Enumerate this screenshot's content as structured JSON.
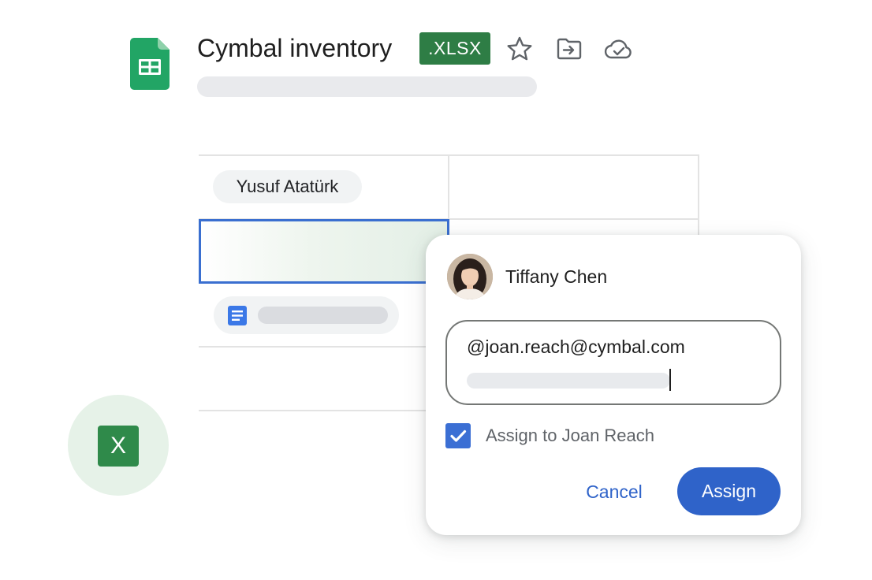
{
  "document": {
    "title": "Cymbal inventory",
    "format_badge": ".XLSX",
    "icons": [
      "google-sheets-icon",
      "star-icon",
      "move-to-folder-icon",
      "cloud-saved-icon"
    ]
  },
  "sheet": {
    "person_chip": "Yusuf Atatürk",
    "doc_chip_icon": "google-docs-icon"
  },
  "excel_icon": {
    "label": "X",
    "icon": "microsoft-excel-icon"
  },
  "assign_card": {
    "assignee_name": "Tiffany Chen",
    "mention_text": "@joan.reach@cymbal.com",
    "checkbox_label": "Assign to Joan Reach",
    "checkbox_checked": true,
    "cancel_label": "Cancel",
    "assign_label": "Assign"
  },
  "colors": {
    "brand_blue": "#2f63c9",
    "sheets_green": "#1e8e3e",
    "excel_green": "#2f8a4a",
    "badge_green": "#2e7d45"
  }
}
